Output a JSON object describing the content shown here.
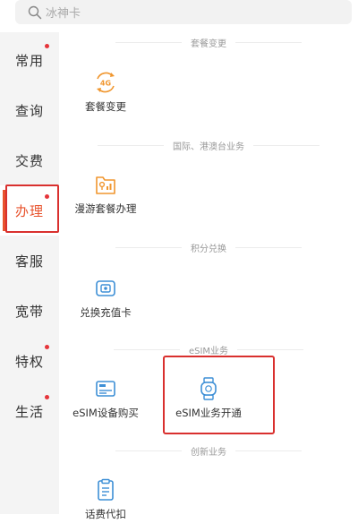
{
  "search": {
    "placeholder": "冰神卡"
  },
  "sidebar": {
    "items": [
      {
        "label": "常用",
        "dot": true,
        "active": false
      },
      {
        "label": "查询",
        "dot": false,
        "active": false
      },
      {
        "label": "交费",
        "dot": false,
        "active": false
      },
      {
        "label": "办理",
        "dot": true,
        "active": true
      },
      {
        "label": "客服",
        "dot": false,
        "active": false
      },
      {
        "label": "宽带",
        "dot": false,
        "active": false
      },
      {
        "label": "特权",
        "dot": true,
        "active": false
      },
      {
        "label": "生活",
        "dot": true,
        "active": false
      }
    ]
  },
  "sections": [
    {
      "title": "套餐变更",
      "items": [
        {
          "label": "套餐变更",
          "icon": "plan-change-4g-icon"
        }
      ]
    },
    {
      "title": "国际、港澳台业务",
      "items": [
        {
          "label": "漫游套餐办理",
          "icon": "roaming-folder-icon"
        }
      ]
    },
    {
      "title": "积分兑换",
      "items": [
        {
          "label": "兑换充值卡",
          "icon": "recharge-card-icon"
        }
      ]
    },
    {
      "title": "eSIM业务",
      "items": [
        {
          "label": "eSIM设备购买",
          "icon": "esim-device-card-icon"
        },
        {
          "label": "eSIM业务开通",
          "icon": "esim-watch-icon"
        }
      ]
    },
    {
      "title": "创新业务",
      "items": [
        {
          "label": "话费代扣",
          "icon": "bill-clipboard-icon"
        }
      ]
    }
  ],
  "colors": {
    "accent": "#e8532d",
    "highlight_frame": "#d9302e",
    "dot": "#e5343a",
    "icon_blue": "#3d8fd6",
    "icon_orange": "#f0962e"
  }
}
